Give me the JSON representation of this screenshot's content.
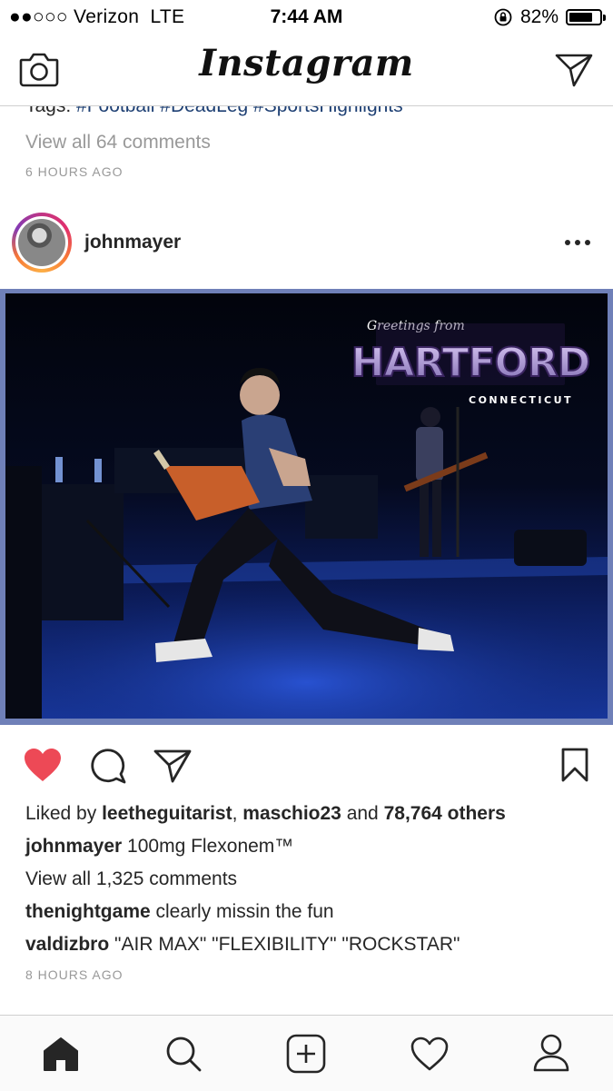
{
  "status_bar": {
    "carrier": "●●○○○ Verizon",
    "network": "LTE",
    "time": "7:44 AM",
    "battery_label": "82%",
    "battery_level": 0.82
  },
  "nav": {
    "title": "Instagram"
  },
  "prev_post": {
    "tags_label": "Tags:",
    "tags": [
      "#Football",
      "#DeadLeg",
      "#SportsHighlights"
    ],
    "view_comments": "View all 64 comments",
    "timestamp": "6 HOURS AGO"
  },
  "post": {
    "username": "johnmayer",
    "photo_text": {
      "greeting": "Greetings from",
      "city": "HARTFORD",
      "state": "CONNECTICUT"
    },
    "likes": {
      "prefix": "Liked by",
      "user1": "leetheguitarist",
      "sep": ",",
      "user2": "maschio23",
      "and": "and",
      "others": "78,764 others"
    },
    "caption": {
      "user": "johnmayer",
      "text": "100mg Flexonem™"
    },
    "view_comments": "View all 1,325 comments",
    "comments": [
      {
        "user": "thenightgame",
        "text": "clearly missin the fun"
      },
      {
        "user": "valdizbro",
        "text": "\"AIR MAX\" \"FLEXIBILITY\" \"ROCKSTAR\""
      }
    ],
    "timestamp": "8 HOURS AGO",
    "liked": true
  },
  "colors": {
    "like_red": "#ed4956",
    "hashtag": "#1d3f73",
    "muted": "#999999"
  },
  "icons": {
    "header": [
      "camera-icon",
      "direct-message-icon"
    ],
    "post": [
      "more-options-icon",
      "heart-icon",
      "comment-icon",
      "share-icon",
      "bookmark-icon"
    ],
    "tabbar": [
      "home-icon",
      "search-icon",
      "add-post-icon",
      "activity-heart-icon",
      "profile-icon"
    ]
  }
}
